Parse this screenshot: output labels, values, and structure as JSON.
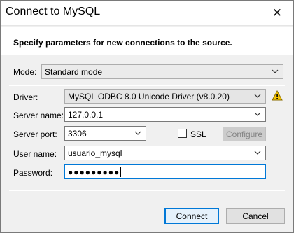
{
  "window": {
    "title": "Connect to MySQL",
    "close_glyph": "✕"
  },
  "header": {
    "text": "Specify parameters for new connections to the source."
  },
  "mode": {
    "label": "Mode:",
    "value": "Standard mode"
  },
  "driver": {
    "label": "Driver:",
    "value": "MySQL ODBC 8.0 Unicode Driver (v8.0.20)",
    "warning_icon": "warning-icon"
  },
  "server_name": {
    "label": "Server name:",
    "value": "127.0.0.1"
  },
  "server_port": {
    "label": "Server port:",
    "value": "3306"
  },
  "ssl": {
    "label": "SSL",
    "checked": false
  },
  "configure": {
    "label": "Configure"
  },
  "user_name": {
    "label": "User name:",
    "value": "usuario_mysql"
  },
  "password": {
    "label": "Password:",
    "value": "●●●●●●●●●"
  },
  "buttons": {
    "connect": "Connect",
    "cancel": "Cancel"
  },
  "colors": {
    "accent": "#0078d7",
    "warning": "#f5c400"
  }
}
